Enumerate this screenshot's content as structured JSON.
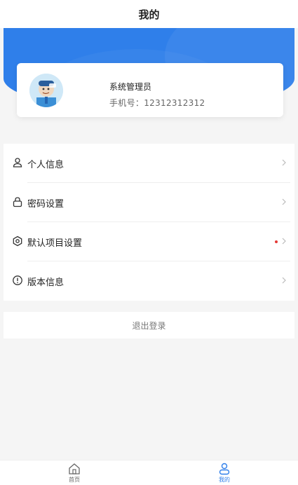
{
  "header": {
    "title": "我的"
  },
  "profile": {
    "name": "系统管理员",
    "phone": "手机号：12312312312"
  },
  "menu": {
    "items": [
      {
        "label": "个人信息",
        "icon": "person-icon"
      },
      {
        "label": "密码设置",
        "icon": "lock-icon"
      },
      {
        "label": "默认项目设置",
        "icon": "hexagon-settings-icon"
      },
      {
        "label": "版本信息",
        "icon": "info-icon"
      }
    ]
  },
  "logout": {
    "label": "退出登录"
  },
  "tabbar": {
    "items": [
      {
        "label": "首页",
        "icon": "home-icon"
      },
      {
        "label": "我的",
        "icon": "person-icon"
      }
    ]
  },
  "colors": {
    "accent": "#2f7fea",
    "badge": "#e53935"
  }
}
